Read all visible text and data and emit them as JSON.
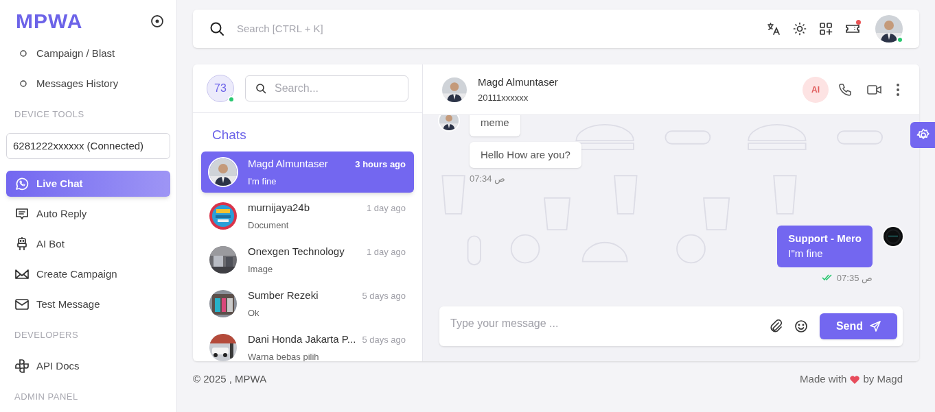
{
  "sidebar": {
    "logo": "MPWA",
    "items": [
      {
        "kind": "subitem",
        "label": "Campaign / Blast"
      },
      {
        "kind": "subitem",
        "label": "Messages History"
      },
      {
        "kind": "heading",
        "label": "DEVICE TOOLS"
      },
      {
        "kind": "device",
        "label": "6281222xxxxxx (Connected)"
      },
      {
        "kind": "nav",
        "label": "Live Chat",
        "selected": true
      },
      {
        "kind": "nav",
        "label": "Auto Reply",
        "selected": false
      },
      {
        "kind": "nav",
        "label": "AI Bot",
        "selected": false
      },
      {
        "kind": "nav",
        "label": "Create Campaign",
        "selected": false
      },
      {
        "kind": "nav",
        "label": "Test Message",
        "selected": false
      },
      {
        "kind": "heading",
        "label": "DEVELOPERS"
      },
      {
        "kind": "nav",
        "label": "API Docs",
        "selected": false
      },
      {
        "kind": "heading",
        "label": "ADMIN PANEL"
      }
    ]
  },
  "topbar": {
    "search": {
      "placeholder": "Search [CTRL + K]"
    },
    "notification_unread": true,
    "user_online": true
  },
  "chat_list": {
    "count": "73",
    "online": true,
    "search": {
      "placeholder": "Search..."
    },
    "title": "Chats",
    "chats": [
      {
        "name": "Magd Almuntaser",
        "time": "3 hours ago",
        "preview": "I'm fine",
        "selected": true
      },
      {
        "name": "murnijaya24b",
        "time": "1 day ago",
        "preview": "Document",
        "selected": false
      },
      {
        "name": "Onexgen Technology",
        "time": "1 day ago",
        "preview": "Image",
        "selected": false
      },
      {
        "name": "Sumber Rezeki",
        "time": "5 days ago",
        "preview": "Ok",
        "selected": false
      },
      {
        "name": "Dani Honda Jakarta P...",
        "time": "5 days ago",
        "preview": "Warna bebas pilih",
        "selected": false
      }
    ]
  },
  "conversation": {
    "contact": {
      "name": "Magd Almuntaser",
      "phone": "20111xxxxxx"
    },
    "ai_badge": "AI",
    "messages": [
      {
        "kind": "incoming",
        "bubbles": [
          "meme",
          "Hello How are you?"
        ],
        "time": "07:34 ص"
      },
      {
        "kind": "outgoing",
        "sender": "Support - Mero",
        "bubbles": [
          "I\"m fine"
        ],
        "time": "07:35 ص",
        "read": true
      }
    ],
    "composer": {
      "placeholder": "Type your message ...",
      "send": "Send"
    }
  },
  "footer": {
    "copyright": "© 2025 , MPWA",
    "made_with": "Made with",
    "by": "by Magd"
  }
}
